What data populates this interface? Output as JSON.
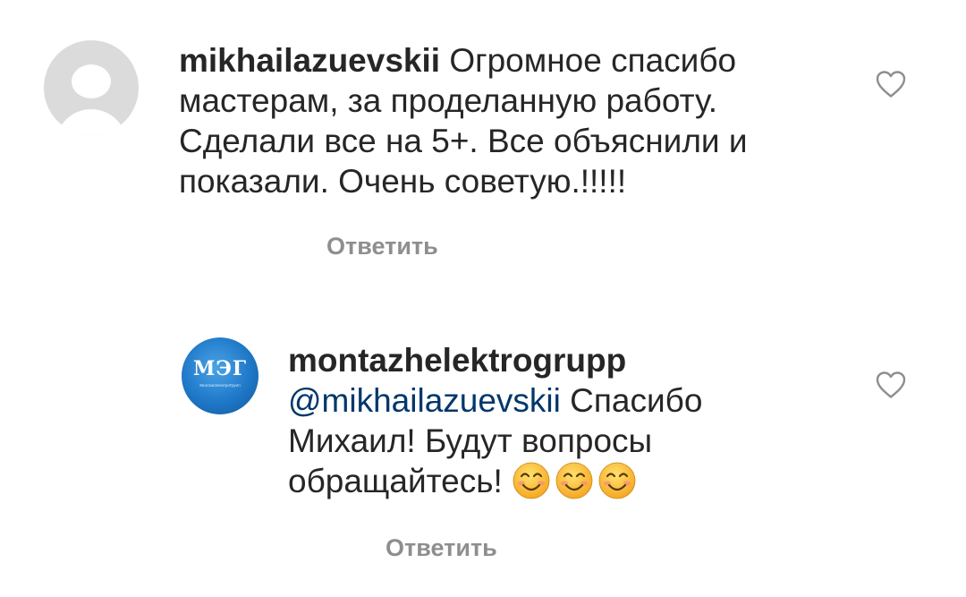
{
  "comments": [
    {
      "username": "mikhailazuevskii",
      "lines": [
        "Огромное спасибо",
        "мастерам, за проделанную работу.",
        "Сделали все на 5+. Все объяснили и",
        "показали. Очень советую.!!!!!"
      ],
      "reply_label": "Ответить",
      "avatar_icon": "default-user-avatar",
      "like_icon": "heart-outline-icon"
    },
    {
      "username": "montazhelektrogrupp",
      "avatar_icon": "brand-logo-avatar",
      "avatar_logo_text": "МЭГ",
      "avatar_logo_subtext": "МонтажЭлектроГрупп",
      "mention": "@mikhailazuevskii",
      "lines": [
        "Спасибо",
        "Михаил! Будут вопросы",
        "обращайтесь!"
      ],
      "emoji": [
        "smiling-face-emoji",
        "smiling-face-emoji",
        "smiling-face-emoji"
      ],
      "reply_label": "Ответить",
      "like_icon": "heart-outline-icon"
    }
  ],
  "colors": {
    "text": "#262626",
    "mention": "#00376b",
    "secondary": "#8e8e8e",
    "avatar_placeholder": "#dbdbdb",
    "brand_blue": "#1f78c8"
  }
}
